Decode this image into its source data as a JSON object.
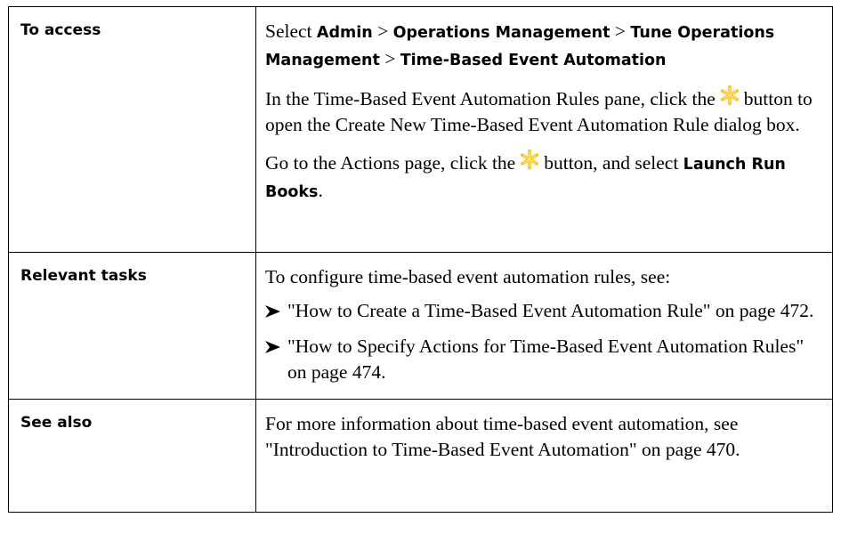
{
  "rows": [
    {
      "label": "To access",
      "select_prefix": "Select ",
      "path": [
        "Admin",
        "Operations Management",
        "Tune Operations Management",
        "Time-Based Event Automation"
      ],
      "path_separator": " > ",
      "para2_before": "In the Time-Based Event Automation Rules pane, click the",
      "para2_after": "button to open the Create New Time-Based Event Automation Rule dialog box.",
      "para3_before": "Go to the Actions page, click the",
      "para3_after": "button, and select",
      "para3_bold": "Launch Run Books",
      "para3_end": "."
    },
    {
      "label": "Relevant tasks",
      "intro": "To configure time-based event automation rules, see:",
      "bullets": [
        "\"How to Create a Time-Based Event Automation Rule\" on page 472.",
        "\"How to Specify Actions for Time-Based Event Automation Rules\" on page 474."
      ]
    },
    {
      "label": "See also",
      "text": "For more information about time-based event automation, see \"Introduction to Time-Based Event Automation\" on page 470."
    }
  ],
  "icons": {
    "new_item": "asterisk-star-icon",
    "bullet": "arrow-bullet-icon",
    "star_color": "#f6c51c"
  }
}
